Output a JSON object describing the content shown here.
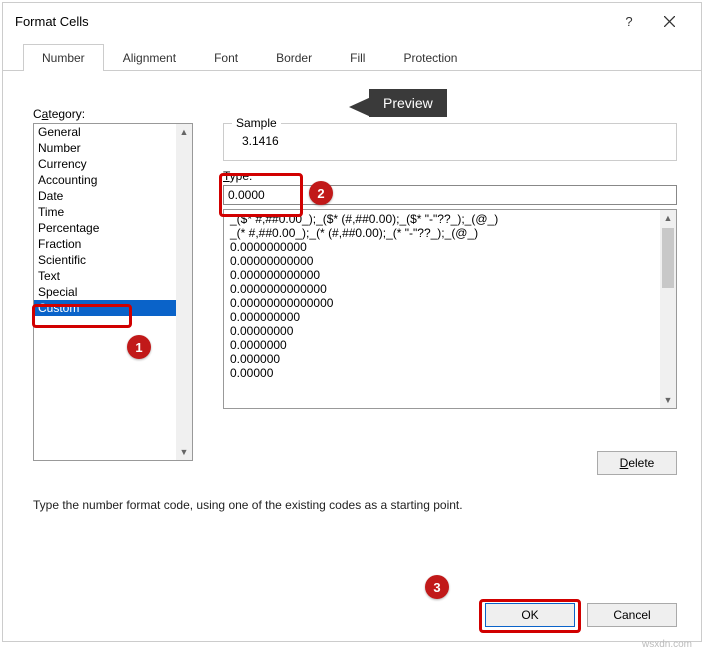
{
  "window": {
    "title": "Format Cells"
  },
  "tabs": {
    "number": "Number",
    "alignment": "Alignment",
    "font": "Font",
    "border": "Border",
    "fill": "Fill",
    "protection": "Protection"
  },
  "category": {
    "label_pre": "C",
    "label_u": "a",
    "label_post": "tegory:",
    "items": [
      "General",
      "Number",
      "Currency",
      "Accounting",
      "Date",
      "Time",
      "Percentage",
      "Fraction",
      "Scientific",
      "Text",
      "Special",
      "Custom"
    ],
    "selected_index": 11
  },
  "sample": {
    "legend": "Sample",
    "value": "3.1416"
  },
  "type": {
    "label_u": "T",
    "label_post": "ype:",
    "value": "0.0000"
  },
  "formats": [
    "_($* #,##0.00_);_($* (#,##0.00);_($* \"-\"??_);_(@_)",
    "_(* #,##0.00_);_(* (#,##0.00);_(* \"-\"??_);_(@_)",
    "0.0000000000",
    "0.00000000000",
    "0.000000000000",
    "0.0000000000000",
    "0.00000000000000",
    "0.000000000",
    "0.00000000",
    "0.0000000",
    "0.000000",
    "0.00000"
  ],
  "delete_label": "Delete",
  "info": "Type the number format code, using one of the existing codes as a starting point.",
  "buttons": {
    "ok": "OK",
    "cancel": "Cancel"
  },
  "annotations": {
    "preview": "Preview",
    "n1": "1",
    "n2": "2",
    "n3": "3"
  },
  "watermark": "wsxdn.com"
}
